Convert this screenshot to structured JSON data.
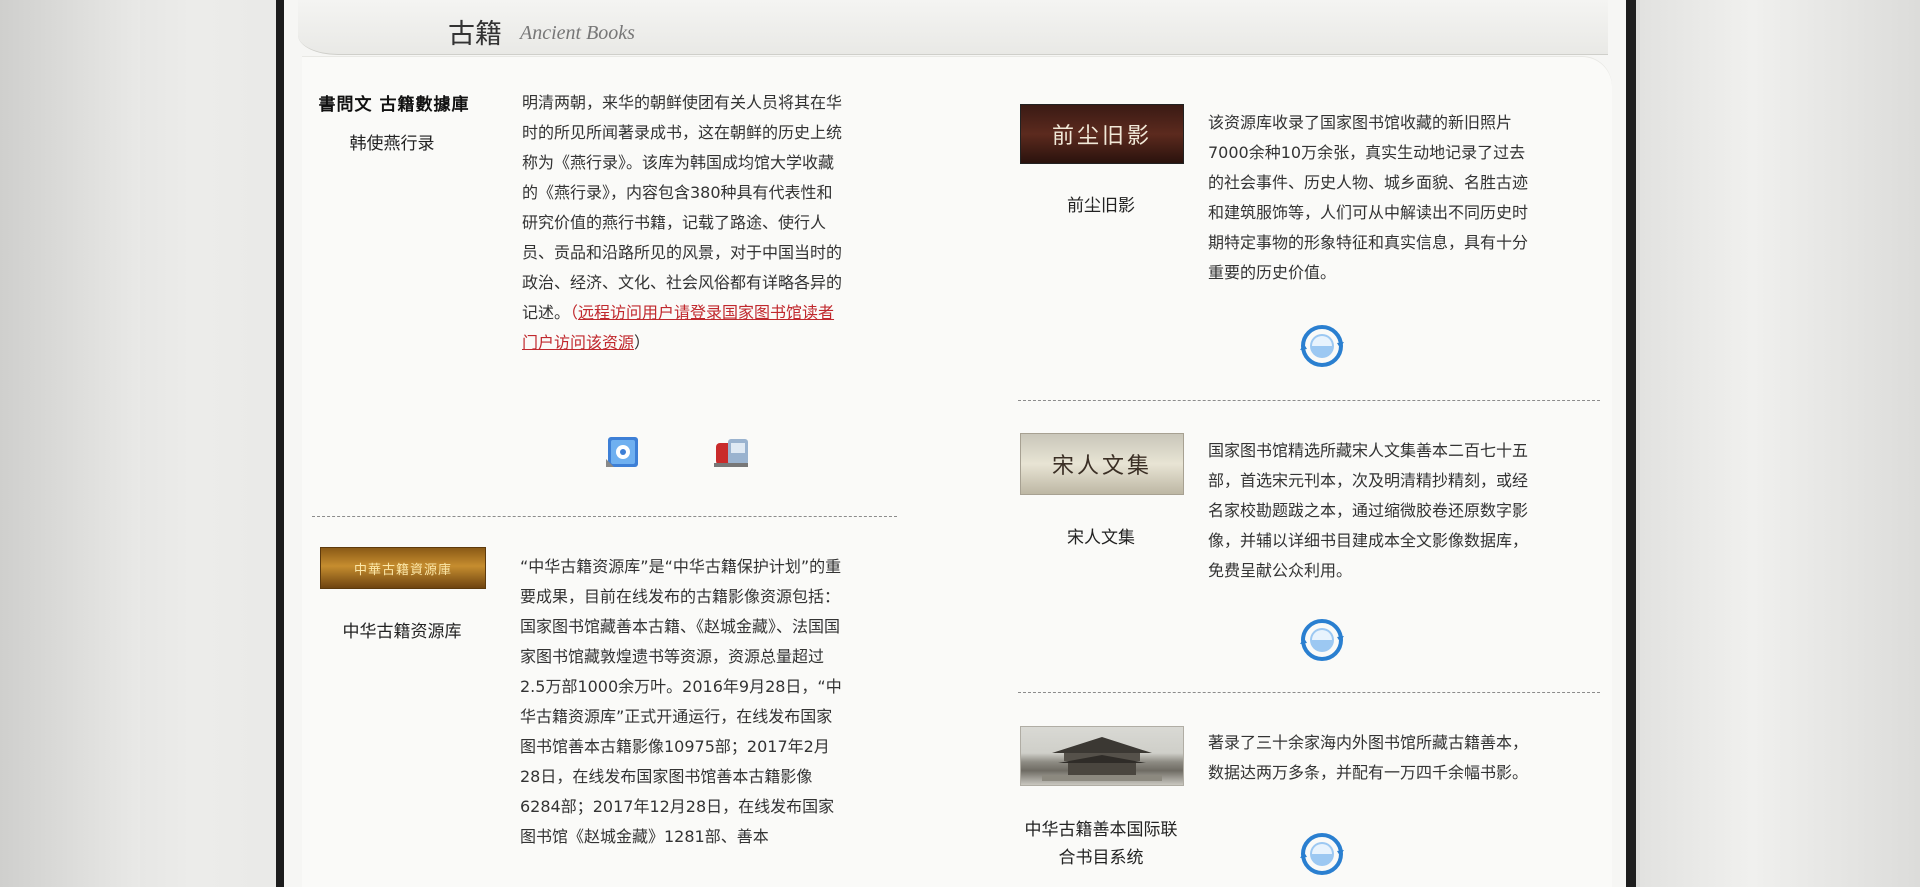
{
  "header": {
    "title_cn": "古籍",
    "title_en": "Ancient Books"
  },
  "left_column": [
    {
      "logo_text": "書問文 古籍數據庫",
      "name": "韩使燕行录",
      "description": "明清两朝，来华的朝鲜使团有关人员将其在华时的所见所闻著录成书，这在朝鲜的历史上统称为《燕行录》。该库为韩国成均馆大学收藏的《燕行录》，内容包含380种具有代表性和研究价值的燕行书籍，记载了路途、使行人员、贡品和沿路所见的风景，对于中国当时的政治、经济、文化、社会风俗都有详略各异的记述。",
      "paren_open": "（",
      "remote_link": "远程访问用户请登录国家图书馆读者门户访问该资源",
      "paren_close": "）",
      "icons": [
        "gear-access-icon",
        "mailbox-access-icon"
      ]
    },
    {
      "logo_text": "中華古籍資源庫",
      "name": "中华古籍资源库",
      "description": "“中华古籍资源库”是“中华古籍保护计划”的重要成果，目前在线发布的古籍影像资源包括：国家图书馆藏善本古籍、《赵城金藏》、法国国家图书馆藏敦煌遗书等资源，资源总量超过2.5万部1000余万叶。2016年9月28日，“中华古籍资源库”正式开通运行，在线发布国家图书馆善本古籍影像10975部；2017年2月28日，在线发布国家图书馆善本古籍影像6284部；2017年12月28日，在线发布国家图书馆《赵城金藏》1281部、善本"
    }
  ],
  "right_column": [
    {
      "logo_text": "前尘旧影",
      "name": "前尘旧影",
      "description": "该资源库收录了国家图书馆收藏的新旧照片7000余种10万余张，真实生动地记录了过去的社会事件、历史人物、城乡面貌、名胜古迹和建筑服饰等，人们可从中解读出不同历史时期特定事物的形象特征和真实信息，具有十分重要的历史价值。"
    },
    {
      "logo_text": "宋人文集",
      "name": "宋人文集",
      "description": "国家图书馆精选所藏宋人文集善本二百七十五部，首选宋元刊本，次及明清精抄精刻，或经名家校勘题跋之本，通过缩微胶卷还原数字影像，并辅以详细书目建成本全文影像数据库，免费呈献公众利用。"
    },
    {
      "logo_text": "",
      "name": "中华古籍善本国际联合书目系统",
      "description": "著录了三十余家海内外图书馆所藏古籍善本，数据达两万多条，并配有一万四千余幅书影。"
    }
  ],
  "colors": {
    "link_red": "#c0282d",
    "access_blue": "#2a7fd0"
  }
}
